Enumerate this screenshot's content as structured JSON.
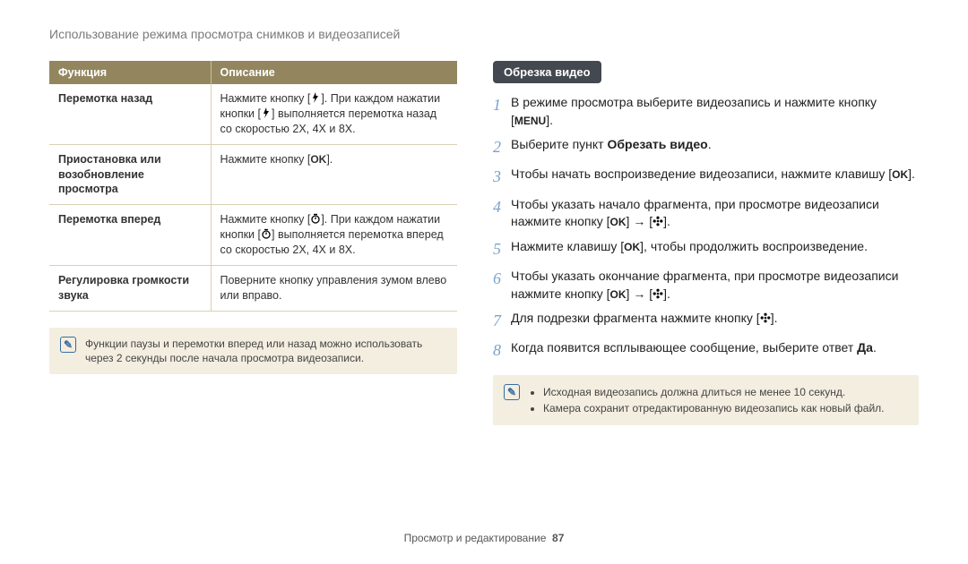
{
  "breadcrumb": "Использование режима просмотра снимков и видеозаписей",
  "table": {
    "headers": [
      "Функция",
      "Описание"
    ],
    "rows": [
      {
        "fn": "Перемотка назад",
        "desc_pre": "Нажмите кнопку [",
        "desc_mid": "]. При каждом нажатии кнопки [",
        "desc_post": "] выполняется перемотка назад со скоростью 2X, 4X и 8X."
      },
      {
        "fn": "Приостановка или возобновление просмотра",
        "desc_pre": "Нажмите кнопку [",
        "desc_post": "]."
      },
      {
        "fn": "Перемотка вперед",
        "desc_pre": "Нажмите кнопку [",
        "desc_mid": "]. При каждом нажатии кнопки [",
        "desc_post": "] выполняется перемотка вперед со скоростью 2X, 4X и 8X."
      },
      {
        "fn": "Регулировка громкости звука",
        "desc": "Поверните кнопку управления зумом влево или вправо."
      }
    ]
  },
  "note_left": "Функции паузы и перемотки вперед или назад можно использовать через 2 секунды после начала просмотра видеозаписи.",
  "right": {
    "title": "Обрезка видео",
    "steps": [
      {
        "n": "1",
        "pre": "В режиме просмотра выберите видеозапись и нажмите кнопку [",
        "icon": "MENU",
        "post": "]."
      },
      {
        "n": "2",
        "pre": "Выберите пункт ",
        "bold": "Обрезать видео",
        "post": "."
      },
      {
        "n": "3",
        "pre": "Чтобы начать воспроизведение видеозаписи, нажмите клавишу [",
        "icon": "OK",
        "post": "]."
      },
      {
        "n": "4",
        "pre": "Чтобы указать начало фрагмента, при просмотре видеозаписи нажмите кнопку [",
        "icon": "OK",
        "mid": "] → [",
        "icon2": "flower",
        "post": "]."
      },
      {
        "n": "5",
        "pre": "Нажмите клавишу [",
        "icon": "OK",
        "post": "], чтобы продолжить воспроизведение."
      },
      {
        "n": "6",
        "pre": "Чтобы указать окончание фрагмента, при просмотре видеозаписи нажмите кнопку [",
        "icon": "OK",
        "mid": "] → [",
        "icon2": "flower",
        "post": "]."
      },
      {
        "n": "7",
        "pre": "Для подрезки фрагмента нажмите кнопку [",
        "icon": "flower",
        "post": "]."
      },
      {
        "n": "8",
        "pre": "Когда появится всплывающее сообщение, выберите ответ ",
        "bold": "Да",
        "post": "."
      }
    ],
    "notes": [
      "Исходная видеозапись должна длиться не менее 10 секунд.",
      "Камера сохранит отредактированную видеозапись как новый файл."
    ]
  },
  "footer": {
    "label": "Просмотр и редактирование",
    "page": "87"
  },
  "icons": {
    "OK": "OK",
    "MENU": "MENU"
  }
}
